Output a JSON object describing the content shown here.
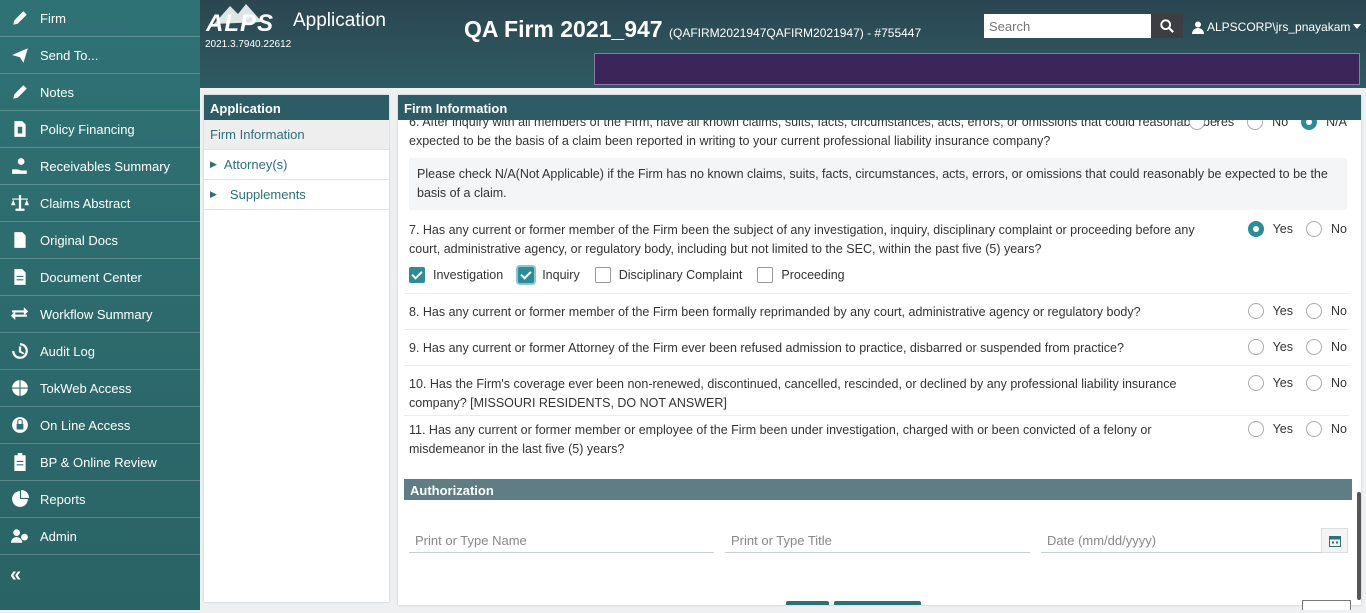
{
  "sidebar": {
    "items": [
      {
        "label": "Firm",
        "icon": "pencil-icon"
      },
      {
        "label": "Send To...",
        "icon": "paper-plane-icon"
      },
      {
        "label": "Notes",
        "icon": "pencil-icon"
      },
      {
        "label": "Policy Financing",
        "icon": "document-dollar-icon"
      },
      {
        "label": "Receivables Summary",
        "icon": "hand-coin-icon"
      },
      {
        "label": "Claims Abstract",
        "icon": "scale-icon"
      },
      {
        "label": "Original Docs",
        "icon": "document-icon"
      },
      {
        "label": "Document Center",
        "icon": "document-lines-icon"
      },
      {
        "label": "Workflow Summary",
        "icon": "exchange-arrows-icon"
      },
      {
        "label": "Audit Log",
        "icon": "history-icon"
      },
      {
        "label": "TokWeb Access",
        "icon": "globe-icon"
      },
      {
        "label": "On Line Access",
        "icon": "lock-icon"
      },
      {
        "label": "BP & Online Review",
        "icon": "clipboard-icon"
      },
      {
        "label": "Reports",
        "icon": "pie-chart-icon"
      },
      {
        "label": "Admin",
        "icon": "users-gear-icon"
      }
    ],
    "collapse_label": "«"
  },
  "header": {
    "logo_text": "ALPS",
    "app_title": "Application",
    "version": "2021.3.7940.22612",
    "firm_name": "QA Firm 2021_947",
    "firm_sub": "(QAFIRM2021947QAFIRM2021947) - #755447",
    "search_placeholder": "Search",
    "user": "ALPSCORP\\jrs_pnayakam",
    "colors": {
      "purple_bar": "#3c2659",
      "header": "#2b4650"
    }
  },
  "app_panel": {
    "title": "Application",
    "items": [
      {
        "label": "Firm Information",
        "active": true
      },
      {
        "label": "Attorney(s)"
      },
      {
        "label": "Supplements"
      }
    ]
  },
  "main": {
    "title": "Firm Information",
    "q6": {
      "text": "6. After inquiry with all members of the Firm, have all known claims, suits, facts, circumstances, acts, errors, or omissions that could reasonably be expected to be the basis of a claim been reported in writing to your current professional liability insurance company?",
      "options": [
        "Yes",
        "No",
        "N/A"
      ],
      "selected": "N/A"
    },
    "note": "Please check N/A(Not Applicable) if the Firm has no known claims, suits, facts, circumstances, acts, errors, or omissions that could reasonably be expected to be the basis of a claim.",
    "q7": {
      "text": "7. Has any current or former member of the Firm been the subject of any investigation, inquiry, disciplinary complaint or proceeding before any court, administrative agency, or regulatory body, including but not limited to the SEC, within the past five (5) years?",
      "selected": "Yes",
      "checks": [
        {
          "label": "Investigation",
          "checked": true
        },
        {
          "label": "Inquiry",
          "checked": true
        },
        {
          "label": "Disciplinary Complaint",
          "checked": false
        },
        {
          "label": "Proceeding",
          "checked": false
        }
      ]
    },
    "q8": {
      "text": "8. Has any current or former member of the Firm been formally reprimanded by any court, administrative agency or regulatory body?"
    },
    "q9": {
      "text": "9. Has any current or former Attorney of the Firm ever been refused admission to practice, disbarred or suspended from practice?"
    },
    "q10": {
      "text": "10. Has the Firm's coverage ever been non-renewed, discontinued, cancelled, rescinded, or declined by any professional liability insurance company? [MISSOURI RESIDENTS, DO NOT ANSWER]"
    },
    "q11": {
      "text": "11. Has any current or former member or employee of the Firm been under investigation, charged with or been convicted of a felony or misdemeanor in the last five (5) years?"
    },
    "yes": "Yes",
    "no": "No",
    "na": "N/A"
  },
  "authorization": {
    "title": "Authorization",
    "name_placeholder": "Print or Type Name",
    "title_placeholder": "Print or Type Title",
    "date_placeholder": "Date (mm/dd/yyyy)"
  }
}
